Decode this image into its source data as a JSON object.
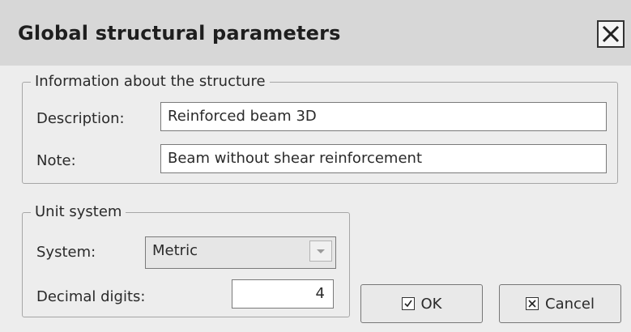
{
  "window": {
    "title": "Global structural parameters",
    "close_icon": "close-x-icon"
  },
  "info_group": {
    "legend": "Information about the structure",
    "description_label": "Description:",
    "description_value": "Reinforced beam 3D",
    "note_label": "Note:",
    "note_value": "Beam without shear reinforcement"
  },
  "unit_group": {
    "legend": "Unit system",
    "system_label": "System:",
    "system_value": "Metric",
    "decimal_label": "Decimal digits:",
    "decimal_value": "4"
  },
  "buttons": {
    "ok_label": "OK",
    "ok_icon": "checkbox-check-icon",
    "cancel_label": "Cancel",
    "cancel_icon": "checkbox-x-icon"
  }
}
